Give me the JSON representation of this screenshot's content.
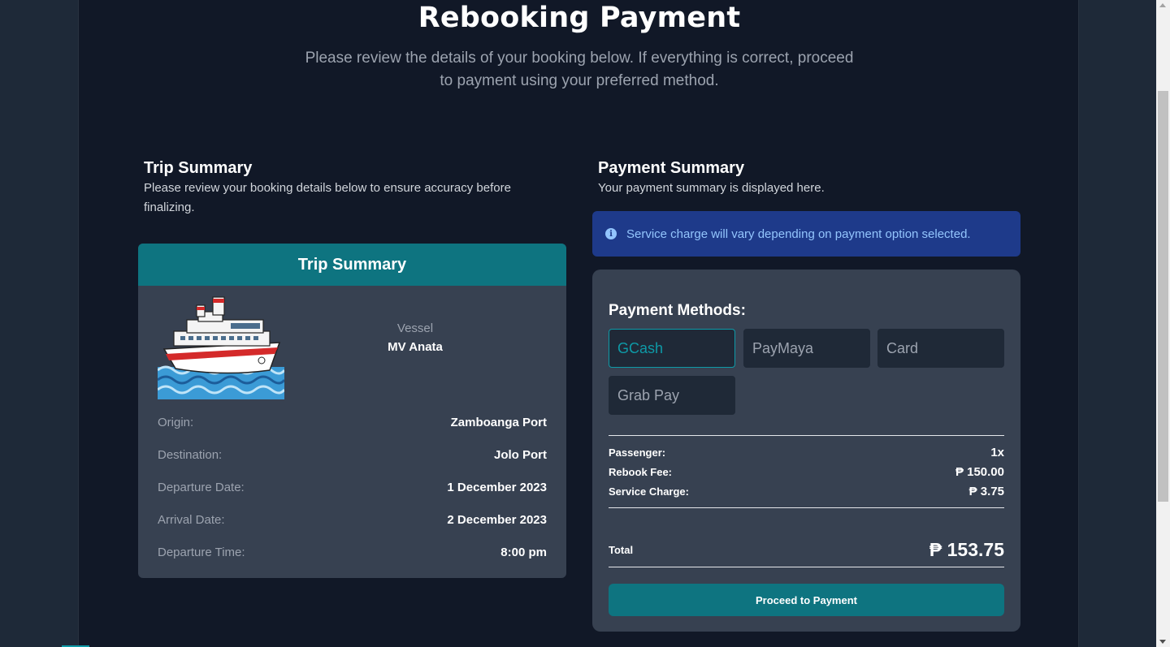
{
  "header": {
    "title": "Rebooking Payment",
    "subtitle": "Please review the details of your booking below. If everything is correct, proceed to payment using your preferred method."
  },
  "trip_section": {
    "title": "Trip Summary",
    "description": "Please review your booking details below to ensure accuracy before finalizing."
  },
  "trip_card": {
    "header": "Trip Summary",
    "vessel_label": "Vessel",
    "vessel_name": "MV Anata",
    "rows": [
      {
        "label": "Origin:",
        "value": "Zamboanga Port"
      },
      {
        "label": "Destination:",
        "value": "Jolo Port"
      },
      {
        "label": "Departure Date:",
        "value": "1 December 2023"
      },
      {
        "label": "Arrival Date:",
        "value": "2 December 2023"
      },
      {
        "label": "Departure Time:",
        "value": "8:00 pm"
      }
    ]
  },
  "payment_section": {
    "title": "Payment Summary",
    "description": "Your payment summary is displayed here.",
    "alert": "Service charge will vary depending on payment option selected."
  },
  "payment_card": {
    "methods_title": "Payment Methods:",
    "methods": [
      "GCash",
      "PayMaya",
      "Card",
      "Grab Pay"
    ],
    "selected_method": "GCash",
    "fees": [
      {
        "label": "Passenger:",
        "value": "1x"
      },
      {
        "label": "Rebook Fee:",
        "value": "₱ 150.00"
      },
      {
        "label": "Service Charge:",
        "value": "₱ 3.75"
      }
    ],
    "total_label": "Total",
    "total_value": "₱ 153.75",
    "proceed_label": "Proceed to Payment"
  },
  "colors": {
    "page_bg": "#111827",
    "card_bg": "#374151",
    "accent": "#0e7480",
    "alert_bg": "#1e3a8a",
    "alert_text": "#93c5fd"
  }
}
